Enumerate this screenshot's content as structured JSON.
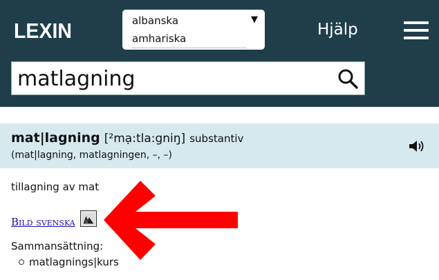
{
  "header": {
    "logo": "LEXIN",
    "language_select": {
      "options_visible": [
        "albanska",
        "amhariska"
      ],
      "selected": "albanska"
    },
    "help_label": "Hjälp"
  },
  "search": {
    "value": "matlagning"
  },
  "entry": {
    "headword": "mat|lagning",
    "pronunciation": "[²mạ:tla:gniŋ]",
    "part_of_speech": "substantiv",
    "inflections": "(mat|lagning, matlagningen, –, –)",
    "definition": "tillagning av mat",
    "image_link": "Bild svenska",
    "compounds_title": "Sammansättning:",
    "compounds": [
      "matlagnings|kurs"
    ]
  },
  "colors": {
    "header_bg": "#1f3e4a",
    "entry_bg": "#d6e9ee",
    "arrow": "#ff0000"
  }
}
